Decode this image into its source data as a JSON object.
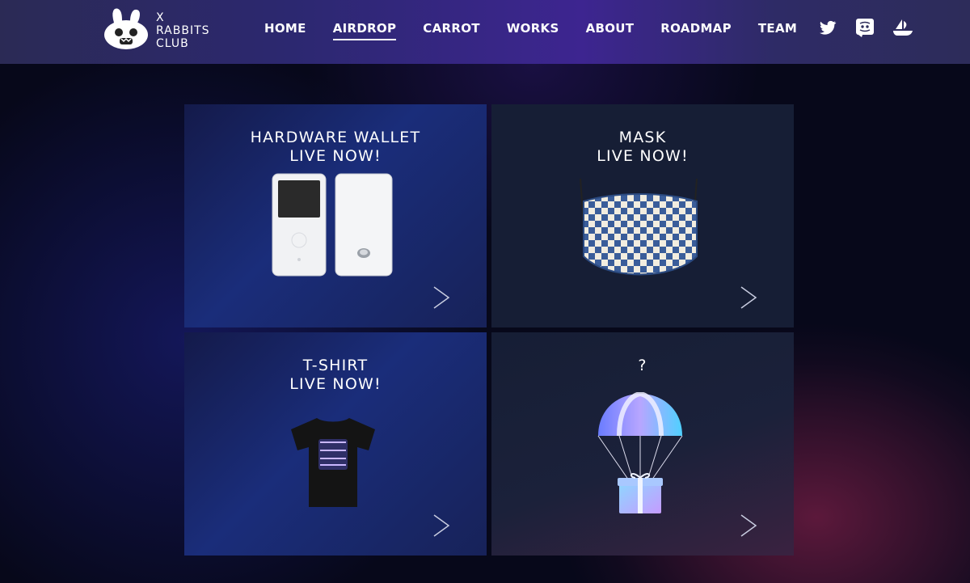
{
  "brand": {
    "lines": [
      "X",
      "RABBITS",
      "CLUB"
    ]
  },
  "nav": {
    "items": [
      {
        "label": "HOME",
        "active": false
      },
      {
        "label": "AIRDROP",
        "active": true
      },
      {
        "label": "CARROT",
        "active": false
      },
      {
        "label": "WORKS",
        "active": false
      },
      {
        "label": "ABOUT",
        "active": false
      },
      {
        "label": "ROADMAP",
        "active": false
      },
      {
        "label": "TEAM",
        "active": false
      }
    ]
  },
  "social": {
    "icons": [
      "twitter-icon",
      "discord-icon",
      "opensea-icon"
    ]
  },
  "cards": [
    {
      "line1": "HARDWARE WALLET",
      "line2": "LIVE NOW!",
      "image": "hardware-wallet"
    },
    {
      "line1": "MASK",
      "line2": "LIVE NOW!",
      "image": "mask"
    },
    {
      "line1": "T-SHIRT",
      "line2": "LIVE NOW!",
      "image": "t-shirt"
    },
    {
      "line1": "?",
      "line2": "",
      "image": "parachute-gift"
    }
  ],
  "colors": {
    "accent": "#3d2590",
    "card_dark": "#161e35",
    "card_blue": "#1a2d7a"
  }
}
